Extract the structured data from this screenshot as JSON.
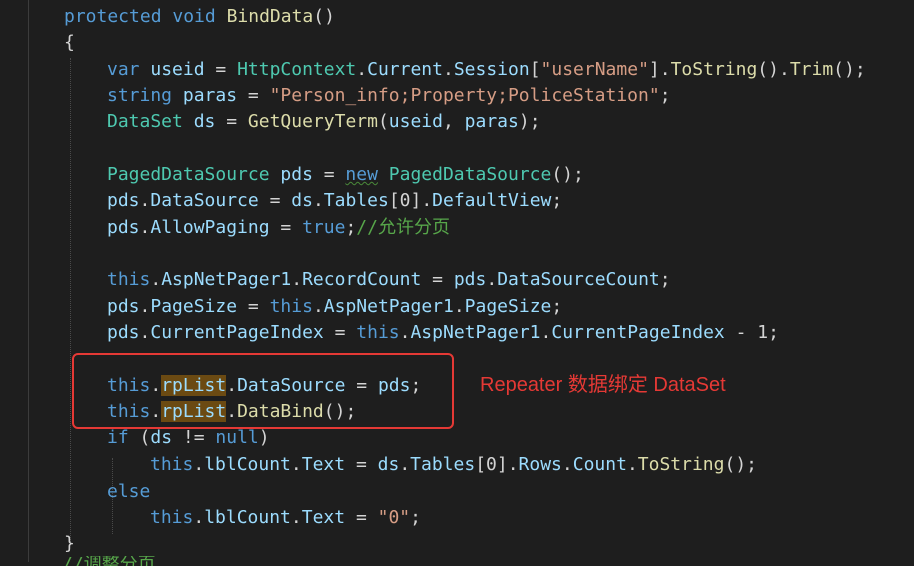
{
  "editor": {
    "lines": [
      [
        {
          "c": "kw",
          "t": "protected "
        },
        {
          "c": "kw",
          "t": "void "
        },
        {
          "c": "fn",
          "t": "BindData"
        },
        {
          "c": "pl",
          "t": "()"
        }
      ],
      [
        {
          "c": "pl",
          "t": "{"
        }
      ],
      [
        {
          "c": "kw",
          "t": "var "
        },
        {
          "c": "id",
          "t": "useid"
        },
        {
          "c": "pl",
          "t": " = "
        },
        {
          "c": "ty",
          "t": "HttpContext"
        },
        {
          "c": "pl",
          "t": "."
        },
        {
          "c": "id",
          "t": "Current"
        },
        {
          "c": "pl",
          "t": "."
        },
        {
          "c": "id",
          "t": "Session"
        },
        {
          "c": "pl",
          "t": "["
        },
        {
          "c": "str",
          "t": "\"userName\""
        },
        {
          "c": "pl",
          "t": "]."
        },
        {
          "c": "fn",
          "t": "ToString"
        },
        {
          "c": "pl",
          "t": "()."
        },
        {
          "c": "fn",
          "t": "Trim"
        },
        {
          "c": "pl",
          "t": "();"
        }
      ],
      [
        {
          "c": "kw",
          "t": "string "
        },
        {
          "c": "id",
          "t": "paras"
        },
        {
          "c": "pl",
          "t": " = "
        },
        {
          "c": "str",
          "t": "\"Person_info;Property;PoliceStation\""
        },
        {
          "c": "pl",
          "t": ";"
        }
      ],
      [
        {
          "c": "ty",
          "t": "DataSet "
        },
        {
          "c": "id",
          "t": "ds"
        },
        {
          "c": "pl",
          "t": " = "
        },
        {
          "c": "fn",
          "t": "GetQueryTerm"
        },
        {
          "c": "pl",
          "t": "("
        },
        {
          "c": "id",
          "t": "useid"
        },
        {
          "c": "pl",
          "t": ", "
        },
        {
          "c": "id",
          "t": "paras"
        },
        {
          "c": "pl",
          "t": ");"
        }
      ],
      [],
      [
        {
          "c": "ty",
          "t": "PagedDataSource "
        },
        {
          "c": "id",
          "t": "pds"
        },
        {
          "c": "pl",
          "t": " = "
        },
        {
          "c": "kw squig",
          "t": "new"
        },
        {
          "c": "pl",
          "t": " "
        },
        {
          "c": "ty",
          "t": "PagedDataSource"
        },
        {
          "c": "pl",
          "t": "();"
        }
      ],
      [
        {
          "c": "id",
          "t": "pds"
        },
        {
          "c": "pl",
          "t": "."
        },
        {
          "c": "id",
          "t": "DataSource"
        },
        {
          "c": "pl",
          "t": " = "
        },
        {
          "c": "id",
          "t": "ds"
        },
        {
          "c": "pl",
          "t": "."
        },
        {
          "c": "id",
          "t": "Tables"
        },
        {
          "c": "pl",
          "t": "[0]."
        },
        {
          "c": "id",
          "t": "DefaultView"
        },
        {
          "c": "pl",
          "t": ";"
        }
      ],
      [
        {
          "c": "id",
          "t": "pds"
        },
        {
          "c": "pl",
          "t": "."
        },
        {
          "c": "id",
          "t": "AllowPaging"
        },
        {
          "c": "pl",
          "t": " = "
        },
        {
          "c": "kw",
          "t": "true"
        },
        {
          "c": "pl",
          "t": ";"
        },
        {
          "c": "cmt",
          "t": "//允许分页"
        }
      ],
      [],
      [
        {
          "c": "kw",
          "t": "this"
        },
        {
          "c": "pl",
          "t": "."
        },
        {
          "c": "id",
          "t": "AspNetPager1"
        },
        {
          "c": "pl",
          "t": "."
        },
        {
          "c": "id",
          "t": "RecordCount"
        },
        {
          "c": "pl",
          "t": " = "
        },
        {
          "c": "id",
          "t": "pds"
        },
        {
          "c": "pl",
          "t": "."
        },
        {
          "c": "id",
          "t": "DataSourceCount"
        },
        {
          "c": "pl",
          "t": ";"
        }
      ],
      [
        {
          "c": "id",
          "t": "pds"
        },
        {
          "c": "pl",
          "t": "."
        },
        {
          "c": "id",
          "t": "PageSize"
        },
        {
          "c": "pl",
          "t": " = "
        },
        {
          "c": "kw",
          "t": "this"
        },
        {
          "c": "pl",
          "t": "."
        },
        {
          "c": "id",
          "t": "AspNetPager1"
        },
        {
          "c": "pl",
          "t": "."
        },
        {
          "c": "id",
          "t": "PageSize"
        },
        {
          "c": "pl",
          "t": ";"
        }
      ],
      [
        {
          "c": "id",
          "t": "pds"
        },
        {
          "c": "pl",
          "t": "."
        },
        {
          "c": "id",
          "t": "CurrentPageIndex"
        },
        {
          "c": "pl",
          "t": " = "
        },
        {
          "c": "kw",
          "t": "this"
        },
        {
          "c": "pl",
          "t": "."
        },
        {
          "c": "id",
          "t": "AspNetPager1"
        },
        {
          "c": "pl",
          "t": "."
        },
        {
          "c": "id",
          "t": "CurrentPageIndex"
        },
        {
          "c": "pl",
          "t": " - 1;"
        }
      ],
      [],
      [
        {
          "c": "kw",
          "t": "this"
        },
        {
          "c": "pl",
          "t": "."
        },
        {
          "c": "id hl",
          "t": "rpList"
        },
        {
          "c": "pl",
          "t": "."
        },
        {
          "c": "id",
          "t": "DataSource"
        },
        {
          "c": "pl",
          "t": " = "
        },
        {
          "c": "id",
          "t": "pds"
        },
        {
          "c": "pl",
          "t": ";"
        }
      ],
      [
        {
          "c": "kw",
          "t": "this"
        },
        {
          "c": "pl",
          "t": "."
        },
        {
          "c": "id hl",
          "t": "rpList"
        },
        {
          "c": "pl",
          "t": "."
        },
        {
          "c": "fn",
          "t": "DataBind"
        },
        {
          "c": "pl",
          "t": "();"
        }
      ],
      [
        {
          "c": "kw",
          "t": "if"
        },
        {
          "c": "pl",
          "t": " ("
        },
        {
          "c": "id",
          "t": "ds"
        },
        {
          "c": "pl",
          "t": " != "
        },
        {
          "c": "kw",
          "t": "null"
        },
        {
          "c": "pl",
          "t": ")"
        }
      ],
      [
        {
          "c": "kw",
          "t": "this"
        },
        {
          "c": "pl",
          "t": "."
        },
        {
          "c": "id",
          "t": "lblCount"
        },
        {
          "c": "pl",
          "t": "."
        },
        {
          "c": "id",
          "t": "Text"
        },
        {
          "c": "pl",
          "t": " = "
        },
        {
          "c": "id",
          "t": "ds"
        },
        {
          "c": "pl",
          "t": "."
        },
        {
          "c": "id",
          "t": "Tables"
        },
        {
          "c": "pl",
          "t": "[0]."
        },
        {
          "c": "id",
          "t": "Rows"
        },
        {
          "c": "pl",
          "t": "."
        },
        {
          "c": "id",
          "t": "Count"
        },
        {
          "c": "pl",
          "t": "."
        },
        {
          "c": "fn",
          "t": "ToString"
        },
        {
          "c": "pl",
          "t": "();"
        }
      ],
      [
        {
          "c": "kw",
          "t": "else"
        }
      ],
      [
        {
          "c": "kw",
          "t": "this"
        },
        {
          "c": "pl",
          "t": "."
        },
        {
          "c": "id",
          "t": "lblCount"
        },
        {
          "c": "pl",
          "t": "."
        },
        {
          "c": "id",
          "t": "Text"
        },
        {
          "c": "pl",
          "t": " = "
        },
        {
          "c": "str",
          "t": "\"0\""
        },
        {
          "c": "pl",
          "t": ";"
        }
      ],
      [
        {
          "c": "pl",
          "t": "}"
        }
      ]
    ],
    "cut_off_comment": "//调整分页"
  },
  "annotation": {
    "text": "Repeater 数据绑定 DataSet",
    "color": "#e53935"
  }
}
